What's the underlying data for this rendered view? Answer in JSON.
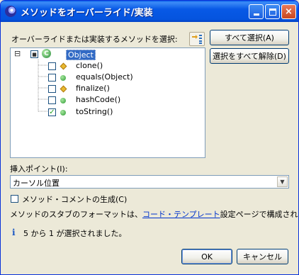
{
  "window": {
    "title": "メソッドをオーバーライド/実装",
    "minimize_label": "minimize",
    "maximize_label": "maximize",
    "close_label": "×"
  },
  "methods_panel": {
    "label": "オーバーライドまたは実装するメソッドを選択:",
    "select_all": "すべて選択(A)",
    "deselect_all": "選択をすべて解除(D)",
    "root": {
      "label": "Object",
      "checked": "partial",
      "expander": "⊟",
      "class_glyph": "C",
      "partial_mark": "■"
    },
    "methods": [
      {
        "label": "clone()",
        "checked": false,
        "icon": "protected-diamond-icon"
      },
      {
        "label": "equals(Object)",
        "checked": false,
        "icon": "public-circle-icon"
      },
      {
        "label": "finalize()",
        "checked": false,
        "icon": "protected-diamond-icon"
      },
      {
        "label": "hashCode()",
        "checked": false,
        "icon": "public-circle-icon"
      },
      {
        "label": "toString()",
        "checked": true,
        "icon": "public-circle-icon"
      }
    ],
    "check_mark": "✓"
  },
  "insertion_point": {
    "label": "挿入ポイント(I):",
    "value": "カーソル位置",
    "arrow": "▼"
  },
  "generate_comments": {
    "label": "メソッド・コメントの生成(C)",
    "checked": false
  },
  "format_note": {
    "prefix": "メソッドのスタブのフォーマットは、",
    "link": "コード・テンプレート",
    "suffix": "設定ページで構成されます。"
  },
  "status": {
    "icon": "i",
    "text": "5 から 1 が選択されました。"
  },
  "buttons": {
    "ok": "OK",
    "cancel": "キャンセル"
  },
  "colors": {
    "title_bar": "#0554de",
    "selection": "#316ac5",
    "link": "#0033cc"
  }
}
